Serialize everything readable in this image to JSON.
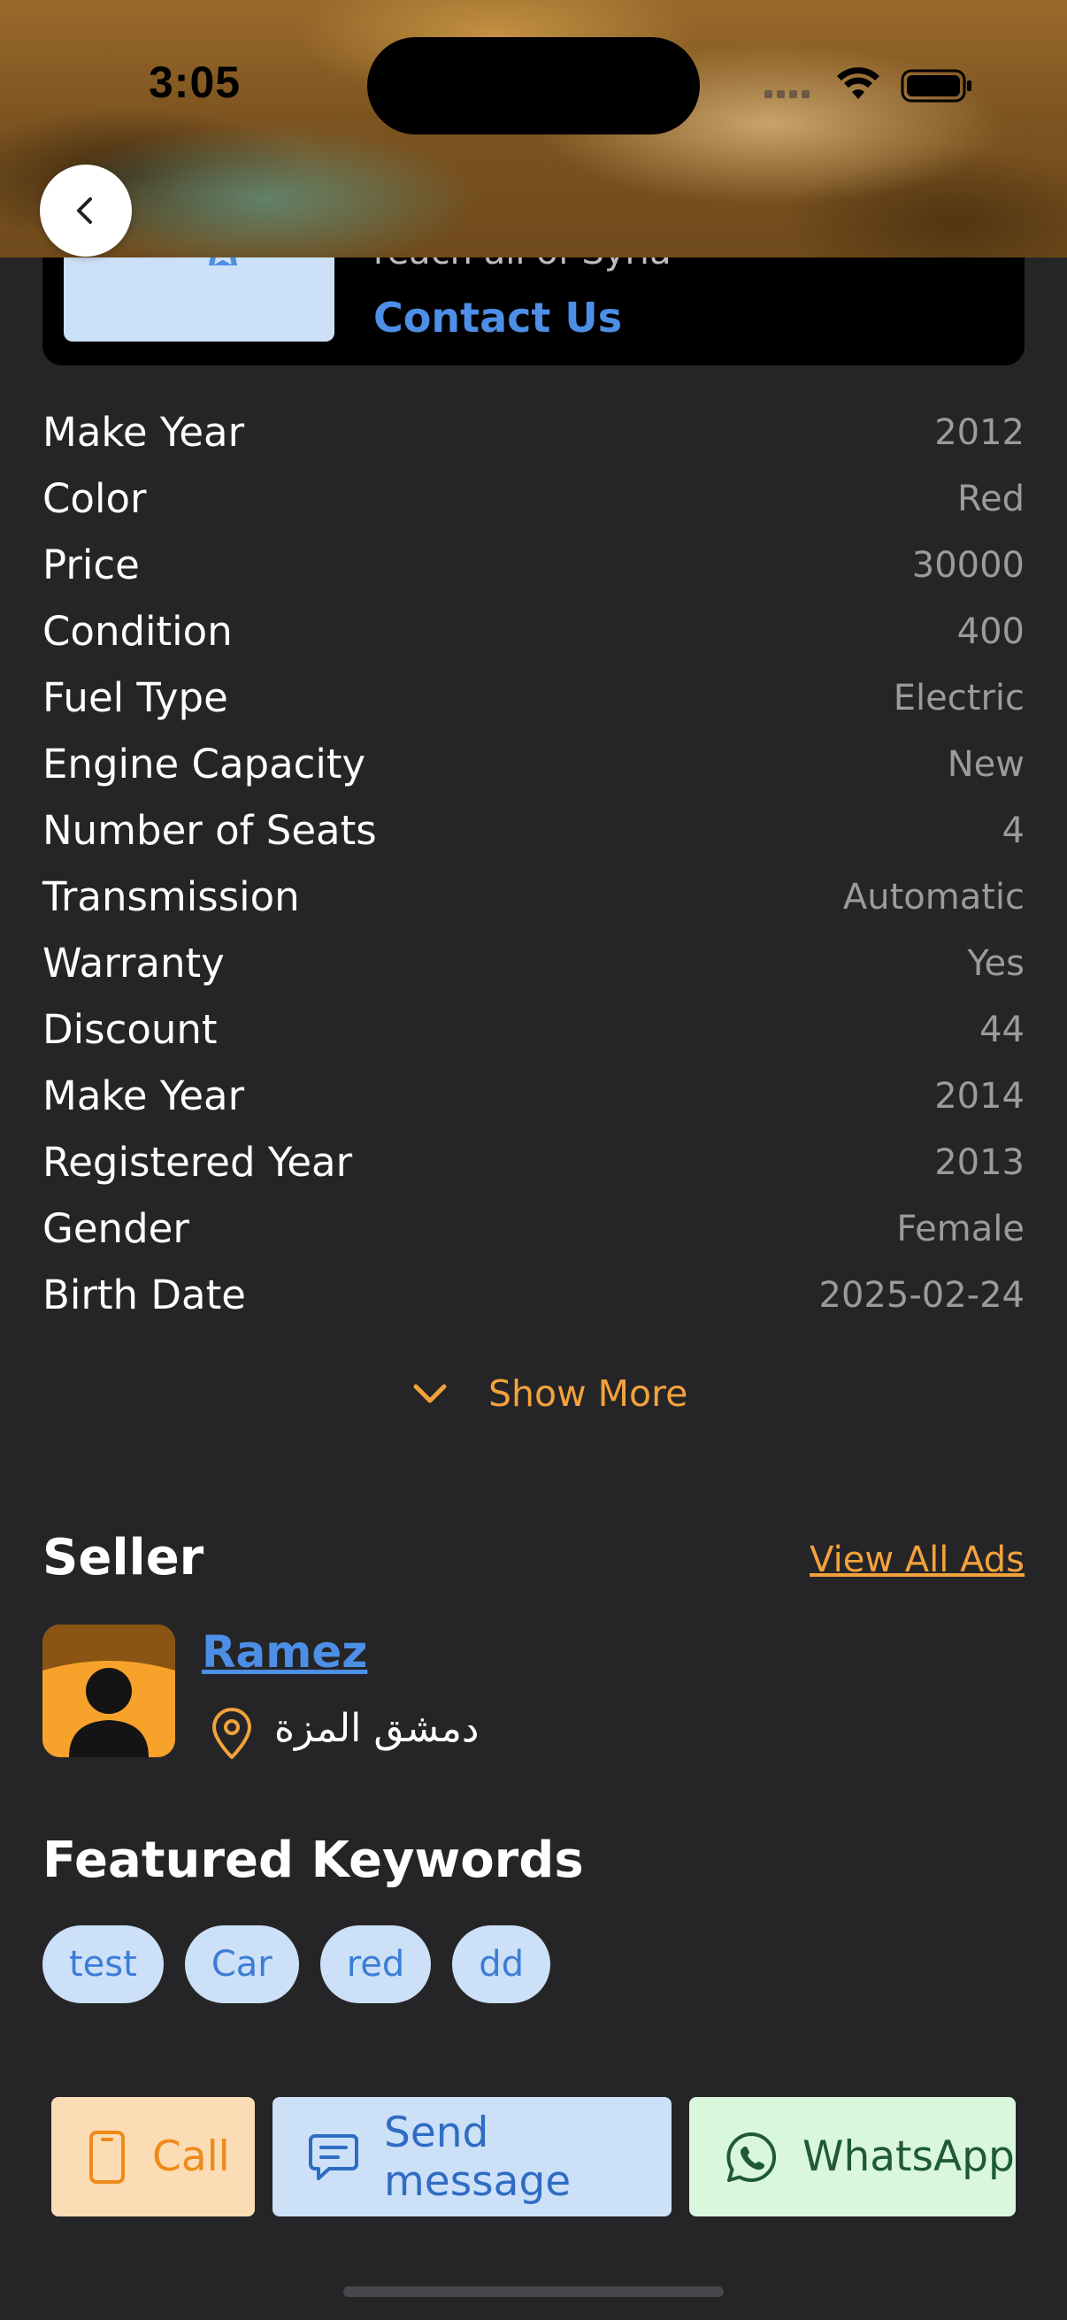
{
  "status_bar": {
    "time": "3:05"
  },
  "promo": {
    "subtitle": "reach all of Syria",
    "cta": "Contact Us"
  },
  "specs": [
    {
      "label": "Make Year",
      "value": "2012"
    },
    {
      "label": "Color",
      "value": "Red"
    },
    {
      "label": "Price",
      "value": "30000"
    },
    {
      "label": "Condition",
      "value": "400"
    },
    {
      "label": "Fuel Type",
      "value": "Electric"
    },
    {
      "label": "Engine Capacity",
      "value": "New"
    },
    {
      "label": "Number of Seats",
      "value": "4"
    },
    {
      "label": "Transmission",
      "value": "Automatic"
    },
    {
      "label": "Warranty",
      "value": "Yes"
    },
    {
      "label": "Discount",
      "value": "44"
    },
    {
      "label": "Make Year",
      "value": "2014"
    },
    {
      "label": "Registered Year",
      "value": "2013"
    },
    {
      "label": "Gender",
      "value": "Female"
    },
    {
      "label": "Birth Date",
      "value": "2025-02-24"
    }
  ],
  "show_more": "Show More",
  "seller": {
    "title": "Seller",
    "view_all": "View All Ads",
    "name": "Ramez",
    "location": "دمشق المزة"
  },
  "keywords": {
    "title": "Featured Keywords",
    "items": [
      "test",
      "Car",
      "red",
      "dd"
    ]
  },
  "actions": {
    "call": "Call",
    "message": "Send message",
    "whatsapp": "WhatsApp"
  },
  "colors": {
    "background": "#252528",
    "accent_orange": "#f3a23b",
    "link_blue": "#4d8fe6",
    "chip_bg": "#cce0f7"
  }
}
